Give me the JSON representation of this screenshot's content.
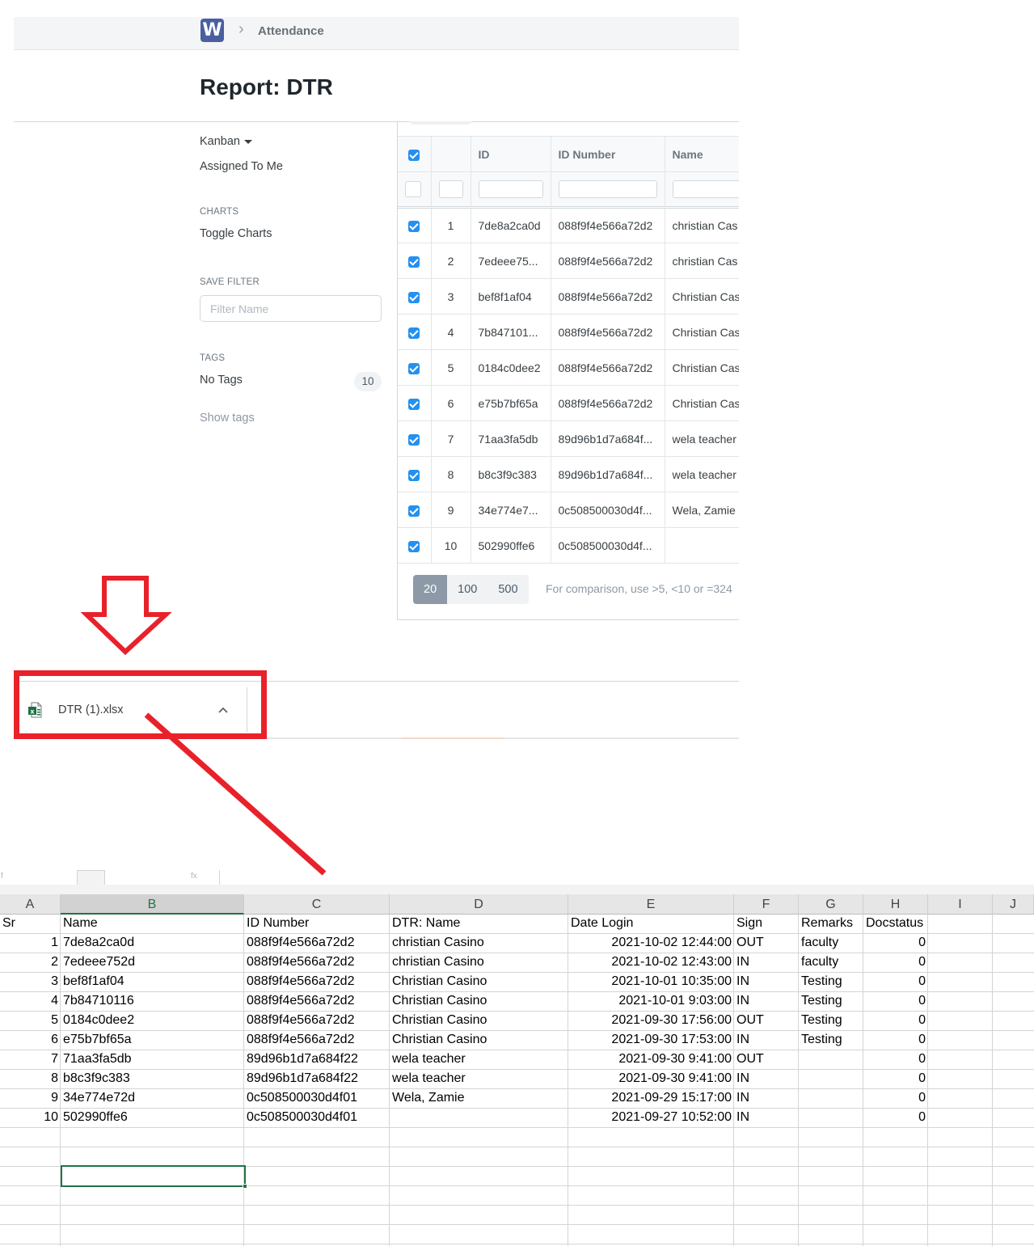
{
  "app": {
    "logo_letter": "W",
    "breadcrumb": "Attendance",
    "page_title": "Report: DTR"
  },
  "sidebar": {
    "kanban": "Kanban",
    "assigned_to_me": "Assigned To Me",
    "charts_heading": "CHARTS",
    "toggle_charts": "Toggle Charts",
    "save_filter_heading": "SAVE FILTER",
    "filter_name_placeholder": "Filter Name",
    "tags_heading": "TAGS",
    "no_tags": "No Tags",
    "no_tags_count": "10",
    "show_tags": "Show tags"
  },
  "report_grid": {
    "columns": [
      "ID",
      "ID Number",
      "Name"
    ],
    "rows": [
      {
        "sr": "1",
        "id": "7de8a2ca0d",
        "id_number": "088f9f4e566a72d2",
        "name": "christian Cas"
      },
      {
        "sr": "2",
        "id": "7edeee75...",
        "id_number": "088f9f4e566a72d2",
        "name": "christian Cas"
      },
      {
        "sr": "3",
        "id": "bef8f1af04",
        "id_number": "088f9f4e566a72d2",
        "name": "Christian Cas"
      },
      {
        "sr": "4",
        "id": "7b847101...",
        "id_number": "088f9f4e566a72d2",
        "name": "Christian Cas"
      },
      {
        "sr": "5",
        "id": "0184c0dee2",
        "id_number": "088f9f4e566a72d2",
        "name": "Christian Cas"
      },
      {
        "sr": "6",
        "id": "e75b7bf65a",
        "id_number": "088f9f4e566a72d2",
        "name": "Christian Cas"
      },
      {
        "sr": "7",
        "id": "71aa3fa5db",
        "id_number": "89d96b1d7a684f...",
        "name": "wela teacher"
      },
      {
        "sr": "8",
        "id": "b8c3f9c383",
        "id_number": "89d96b1d7a684f...",
        "name": "wela teacher"
      },
      {
        "sr": "9",
        "id": "34e774e7...",
        "id_number": "0c508500030d4f...",
        "name": "Wela, Zamie"
      },
      {
        "sr": "10",
        "id": "502990ffe6",
        "id_number": "0c508500030d4f...",
        "name": ""
      }
    ],
    "page_sizes": [
      "20",
      "100",
      "500"
    ],
    "comparison_hint": "For comparison, use >5, <10 or =324"
  },
  "download_bar": {
    "file_name": "DTR (1).xlsx"
  },
  "spreadsheet": {
    "toolbar_fragment": [
      "f",
      "fx"
    ],
    "column_letters": [
      "A",
      "B",
      "C",
      "D",
      "E",
      "F",
      "G",
      "H",
      "I",
      "J"
    ],
    "header_row": {
      "a": "Sr",
      "b": "Name",
      "c": "ID Number",
      "d": "DTR: Name",
      "e": "Date Login",
      "f": "Sign",
      "g": "Remarks",
      "h": "Docstatus"
    },
    "rows": [
      {
        "sr": "1",
        "name": "7de8a2ca0d",
        "id_number": "088f9f4e566a72d2",
        "dtr_name": "christian Casino",
        "date_login": "2021-10-02 12:44:00",
        "sign": "OUT",
        "remarks": "faculty",
        "docstatus": "0"
      },
      {
        "sr": "2",
        "name": "7edeee752d",
        "id_number": "088f9f4e566a72d2",
        "dtr_name": "christian Casino",
        "date_login": "2021-10-02 12:43:00",
        "sign": "IN",
        "remarks": "faculty",
        "docstatus": "0"
      },
      {
        "sr": "3",
        "name": "bef8f1af04",
        "id_number": "088f9f4e566a72d2",
        "dtr_name": "Christian Casino",
        "date_login": "2021-10-01 10:35:00",
        "sign": "IN",
        "remarks": "Testing",
        "docstatus": "0"
      },
      {
        "sr": "4",
        "name": "7b84710116",
        "id_number": "088f9f4e566a72d2",
        "dtr_name": "Christian Casino",
        "date_login": "2021-10-01 9:03:00",
        "sign": "IN",
        "remarks": "Testing",
        "docstatus": "0"
      },
      {
        "sr": "5",
        "name": "0184c0dee2",
        "id_number": "088f9f4e566a72d2",
        "dtr_name": "Christian Casino",
        "date_login": "2021-09-30 17:56:00",
        "sign": "OUT",
        "remarks": "Testing",
        "docstatus": "0"
      },
      {
        "sr": "6",
        "name": "e75b7bf65a",
        "id_number": "088f9f4e566a72d2",
        "dtr_name": "Christian Casino",
        "date_login": "2021-09-30 17:53:00",
        "sign": "IN",
        "remarks": "Testing",
        "docstatus": "0"
      },
      {
        "sr": "7",
        "name": "71aa3fa5db",
        "id_number": "89d96b1d7a684f22",
        "dtr_name": "wela teacher",
        "date_login": "2021-09-30 9:41:00",
        "sign": "OUT",
        "remarks": "",
        "docstatus": "0"
      },
      {
        "sr": "8",
        "name": "b8c3f9c383",
        "id_number": "89d96b1d7a684f22",
        "dtr_name": "wela teacher",
        "date_login": "2021-09-30 9:41:00",
        "sign": "IN",
        "remarks": "",
        "docstatus": "0"
      },
      {
        "sr": "9",
        "name": "34e774e72d",
        "id_number": "0c508500030d4f01",
        "dtr_name": "Wela, Zamie",
        "date_login": "2021-09-29 15:17:00",
        "sign": "IN",
        "remarks": "",
        "docstatus": "0"
      },
      {
        "sr": "10",
        "name": "502990ffe6",
        "id_number": "0c508500030d4f01",
        "dtr_name": "",
        "date_login": "2021-09-27 10:52:00",
        "sign": "IN",
        "remarks": "",
        "docstatus": "0"
      }
    ],
    "selected_cell": "B14"
  },
  "colors": {
    "accent_blue": "#2490ef",
    "annotation_red": "#e8212a",
    "excel_green": "#217346",
    "logo_blue": "#4a5f9f"
  }
}
